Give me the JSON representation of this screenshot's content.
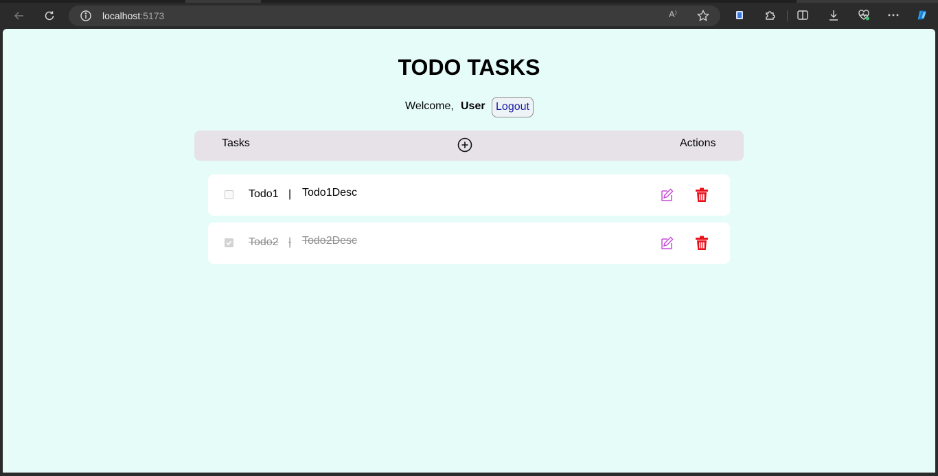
{
  "browser": {
    "url_host": "localhost",
    "url_port": ":5173",
    "read_aloud_label": "A⁾"
  },
  "page": {
    "title": "TODO TASKS",
    "welcome_text": "Welcome,",
    "username": "User",
    "logout_label": "Logout"
  },
  "table": {
    "tasks_header": "Tasks",
    "actions_header": "Actions"
  },
  "todos": [
    {
      "title": "Todo1",
      "separator": "|",
      "description": "Todo1Desc",
      "completed": false
    },
    {
      "title": "Todo2",
      "separator": "|",
      "description": "Todo2Desc",
      "completed": true
    }
  ],
  "colors": {
    "background": "#e6fcf9",
    "header_bg": "#e6e2e8",
    "edit_icon": "#c64dd8",
    "delete_icon": "#e8101a",
    "logout_text": "#1a1aa6"
  },
  "icons": {
    "add": "plus-circle-icon",
    "edit": "edit-icon",
    "delete": "trash-icon"
  }
}
